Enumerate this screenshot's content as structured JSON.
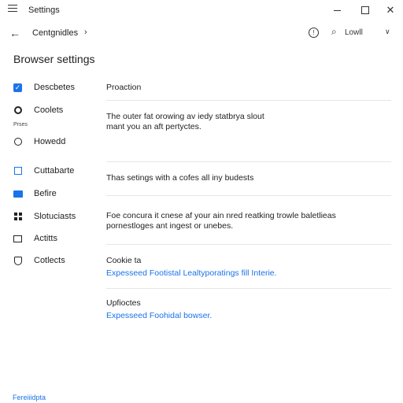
{
  "window": {
    "title": "Settings"
  },
  "nav": {
    "breadcrumb": "Centgnidles",
    "search_label": "Lowll"
  },
  "page": {
    "title": "Browser settings"
  },
  "sidebar": {
    "items": [
      {
        "label": "Descbetes"
      },
      {
        "label": "Coolets",
        "sublabel": "Prses"
      },
      {
        "label": "Howedd"
      },
      {
        "label": "Cuttabarte"
      },
      {
        "label": "Befire"
      },
      {
        "label": "Slotuciasts"
      },
      {
        "label": "Actitts"
      },
      {
        "label": "Cotlects"
      }
    ]
  },
  "main": {
    "section1": {
      "title": "Proaction"
    },
    "section2": {
      "line1": "The outer fat orowing av iedy statbrya slout",
      "line2": "mant you an aft pertyctes."
    },
    "section3": {
      "line1": "Thas setings with a cofes all iny budests"
    },
    "section4": {
      "line1": "Foe concura it cnese af your ain nred reatking trowle baletlieas",
      "line2": "pornestloges ant ingest or unebes."
    },
    "section5": {
      "title": "Cookie ta",
      "link": "Expesseed Footistal Lealtyporatings fill Interie."
    },
    "section6": {
      "title": "Upfioctes",
      "link": "Expesseed Foohidal bowser."
    }
  },
  "footer": {
    "link": "Fereiiidpta"
  },
  "colors": {
    "accent": "#1a73e8",
    "text": "#1f1f1f",
    "divider": "#e6e6e6"
  }
}
